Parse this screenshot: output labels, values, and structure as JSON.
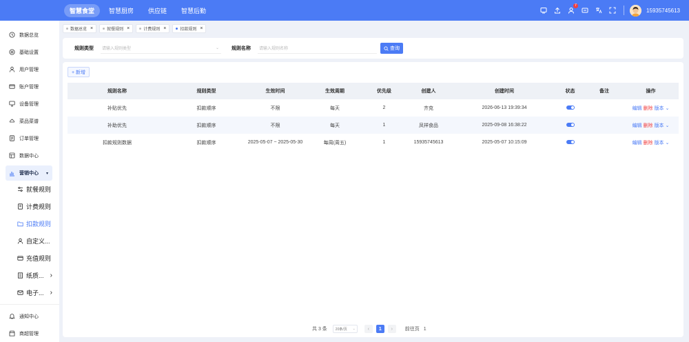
{
  "header": {
    "nav": [
      "智慧食堂",
      "智慧厨房",
      "供应链",
      "智慧后勤"
    ],
    "badge_count": "7",
    "username": "15935745613"
  },
  "sidebar": {
    "items_top": [
      {
        "label": "数据总览",
        "icon": "clock-icon"
      },
      {
        "label": "基础设置",
        "icon": "settings-icon"
      },
      {
        "label": "用户管理",
        "icon": "user-icon"
      },
      {
        "label": "账户管理",
        "icon": "card-icon"
      },
      {
        "label": "设备管理",
        "icon": "monitor-icon"
      },
      {
        "label": "菜品菜谱",
        "icon": "dish-icon"
      },
      {
        "label": "订单管理",
        "icon": "order-icon"
      },
      {
        "label": "数据中心",
        "icon": "data-icon"
      }
    ],
    "group": {
      "label": "营销中心",
      "icon": "chart-icon"
    },
    "sub_items": [
      {
        "label": "就餐规则",
        "icon": "sliders-icon"
      },
      {
        "label": "计费规则",
        "icon": "doc-icon"
      },
      {
        "label": "扣款规则",
        "icon": "folder-icon"
      },
      {
        "label": "自定义...",
        "icon": "user-icon"
      },
      {
        "label": "充值规则",
        "icon": "card-icon"
      },
      {
        "label": "纸质...",
        "icon": "paper-icon"
      },
      {
        "label": "电子...",
        "icon": "mail-icon"
      }
    ],
    "items_bottom": [
      {
        "label": "通知中心",
        "icon": "bell-icon"
      },
      {
        "label": "商超管理",
        "icon": "shop-icon"
      }
    ]
  },
  "tabs": [
    {
      "label": "数据总览"
    },
    {
      "label": "就餐规则"
    },
    {
      "label": "计费规则"
    },
    {
      "label": "扣款规则"
    }
  ],
  "filter": {
    "type_label": "规则类型",
    "type_placeholder": "请输入规则类型",
    "name_label": "规则名称",
    "name_placeholder": "请输入规则名称",
    "query_label": "查询"
  },
  "toolbar": {
    "add_label": "+ 新增"
  },
  "table": {
    "columns": [
      "规则名称",
      "规则类型",
      "生效时间",
      "生效周期",
      "优先级",
      "创建人",
      "创建时间",
      "状态",
      "备注",
      "操作"
    ],
    "rows": [
      {
        "name": "补贴优先",
        "type": "扣款顺序",
        "time": "不限",
        "cycle": "每天",
        "priority": "2",
        "creator": "齐克",
        "created": "2026-06-13 19:39:34",
        "remark": ""
      },
      {
        "name": "补助优先",
        "type": "扣款顺序",
        "time": "不限",
        "cycle": "每天",
        "priority": "1",
        "creator": "凤祥食品",
        "created": "2025-09-08 16:38:22",
        "remark": ""
      },
      {
        "name": "扣款规则数据",
        "type": "扣款顺序",
        "time": "2025-05-07 ~ 2025-05-30",
        "cycle": "每周(周五)",
        "priority": "1",
        "creator": "15935745613",
        "created": "2025-05-07 10:15:09",
        "remark": ""
      }
    ],
    "ops": {
      "edit": "编辑",
      "delete": "删除",
      "version": "版本"
    }
  },
  "pagination": {
    "total": "共 3 条",
    "page_size": "20条/页",
    "current": "1",
    "goto_label": "前往页",
    "goto_value": "1"
  },
  "colors": {
    "primary": "#4b7bf5",
    "danger": "#f04040"
  }
}
